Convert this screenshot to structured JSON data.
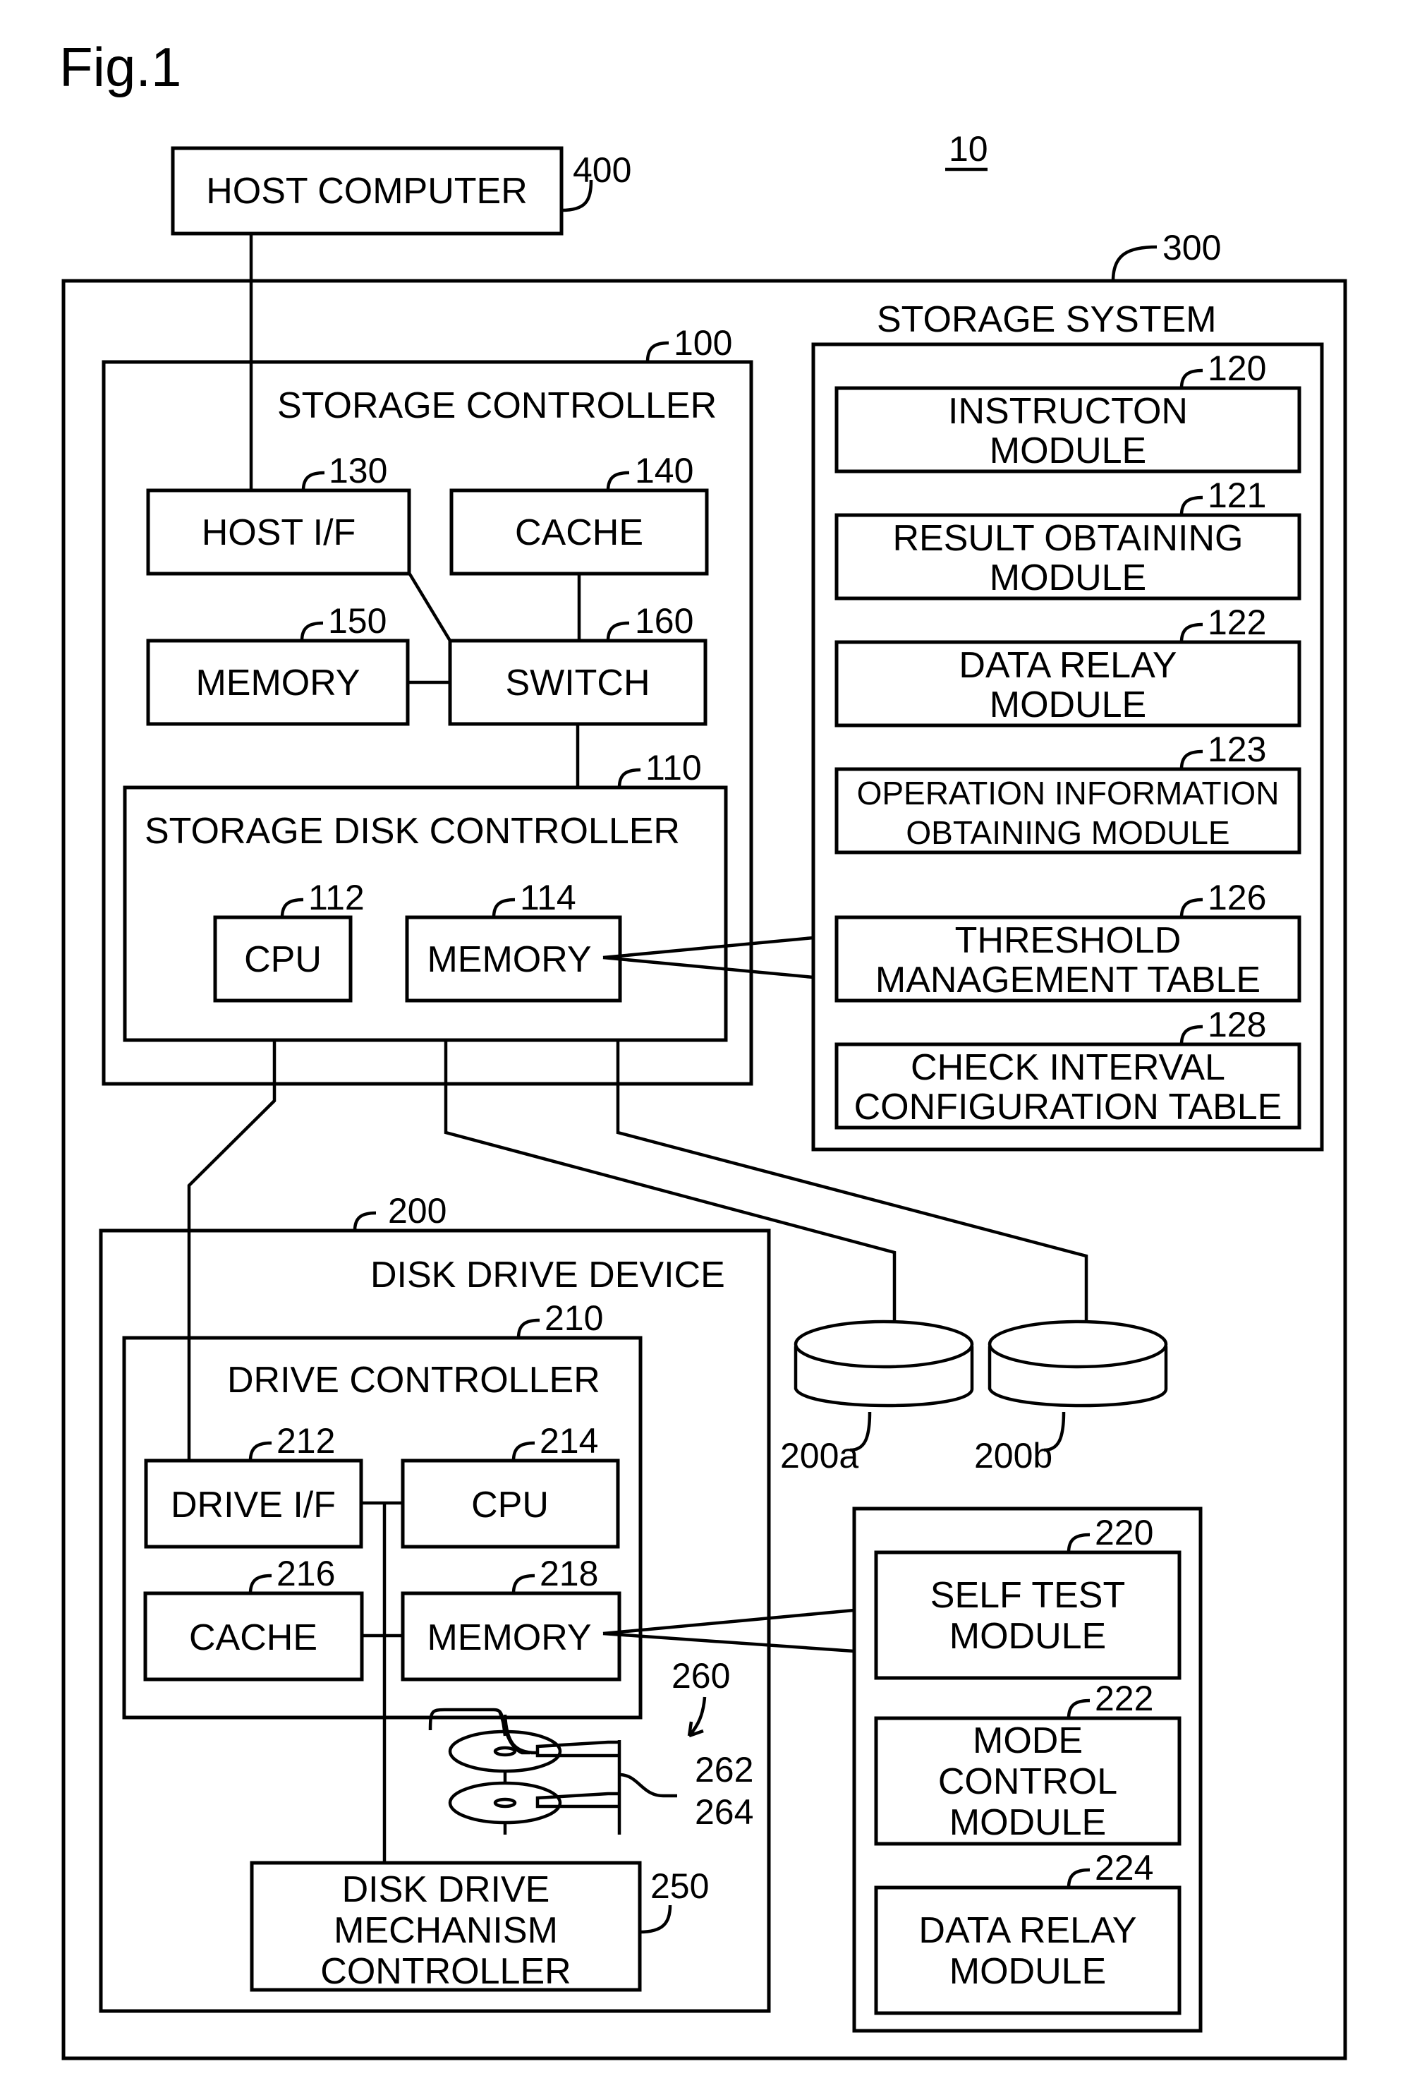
{
  "figure_title": "Fig.1",
  "system_ref": "10",
  "host_computer": {
    "label": "HOST COMPUTER",
    "ref": "400"
  },
  "storage_system": {
    "ref": "300",
    "label": "STORAGE SYSTEM",
    "modules": [
      {
        "ref": "120",
        "lines": [
          "INSTRUCTON",
          "MODULE"
        ]
      },
      {
        "ref": "121",
        "lines": [
          "RESULT OBTAINING",
          "MODULE"
        ]
      },
      {
        "ref": "122",
        "lines": [
          "DATA RELAY",
          "MODULE"
        ]
      },
      {
        "ref": "123",
        "lines": [
          "OPERATION INFORMATION",
          "OBTAINING MODULE"
        ]
      },
      {
        "ref": "126",
        "lines": [
          "THRESHOLD",
          "MANAGEMENT TABLE"
        ]
      },
      {
        "ref": "128",
        "lines": [
          "CHECK INTERVAL",
          "CONFIGURATION TABLE"
        ]
      }
    ]
  },
  "storage_controller": {
    "ref": "100",
    "label": "STORAGE CONTROLLER",
    "host_if": {
      "label": "HOST I/F",
      "ref": "130"
    },
    "cache": {
      "label": "CACHE",
      "ref": "140"
    },
    "memory": {
      "label": "MEMORY",
      "ref": "150"
    },
    "switch": {
      "label": "SWITCH",
      "ref": "160"
    },
    "disk_controller": {
      "ref": "110",
      "label": "STORAGE DISK CONTROLLER",
      "cpu": {
        "label": "CPU",
        "ref": "112"
      },
      "memory": {
        "label": "MEMORY",
        "ref": "114"
      }
    }
  },
  "disk_drive_device": {
    "ref": "200",
    "label": "DISK DRIVE DEVICE",
    "drive_controller": {
      "ref": "210",
      "label": "DRIVE CONTROLLER",
      "drive_if": {
        "label": "DRIVE I/F",
        "ref": "212"
      },
      "cpu": {
        "label": "CPU",
        "ref": "214"
      },
      "cache": {
        "label": "CACHE",
        "ref": "216"
      },
      "memory": {
        "label": "MEMORY",
        "ref": "218"
      }
    },
    "mechanism_controller": {
      "lines": [
        "DISK DRIVE",
        "MECHANISM",
        "CONTROLLER"
      ],
      "ref": "250"
    },
    "disk_assembly": {
      "ref": "260",
      "platter_ref": "262",
      "head_ref": "264"
    }
  },
  "extra_drives": [
    {
      "ref": "200a"
    },
    {
      "ref": "200b"
    }
  ],
  "drive_modules": [
    {
      "ref": "220",
      "lines": [
        "SELF TEST",
        "MODULE"
      ]
    },
    {
      "ref": "222",
      "lines": [
        "MODE",
        "CONTROL",
        "MODULE"
      ]
    },
    {
      "ref": "224",
      "lines": [
        "DATA RELAY",
        "MODULE"
      ]
    }
  ]
}
